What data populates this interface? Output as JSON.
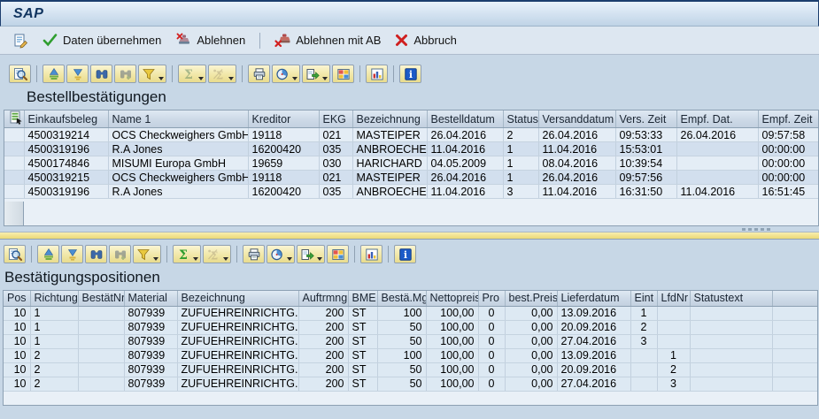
{
  "window": {
    "title": "SAP"
  },
  "app_toolbar": {
    "buttons": [
      {
        "name": "edit-document",
        "label": "",
        "icon": "doc-pencil"
      },
      {
        "name": "accept-data",
        "label": "Daten übernehmen",
        "icon": "green-check"
      },
      {
        "name": "reject",
        "label": "Ablehnen",
        "icon": "stamp-reject"
      },
      {
        "name": "reject-with-ab",
        "label": "Ablehnen mit AB",
        "icon": "stamp-reject-ab"
      },
      {
        "name": "cancel",
        "label": "Abbruch",
        "icon": "red-x"
      }
    ]
  },
  "alv_toolbar": {
    "buttons": [
      {
        "name": "choose-detail",
        "group_end": true
      },
      {
        "name": "sort-ascending"
      },
      {
        "name": "sort-descending"
      },
      {
        "name": "find"
      },
      {
        "name": "find-next"
      },
      {
        "name": "filter",
        "dropdown": true,
        "group_end": true
      },
      {
        "name": "sum",
        "dropdown": true
      },
      {
        "name": "subtotal",
        "dropdown": true,
        "group_end": true
      },
      {
        "name": "print"
      },
      {
        "name": "views",
        "dropdown": true
      },
      {
        "name": "export",
        "dropdown": true
      },
      {
        "name": "layout",
        "group_end": true
      },
      {
        "name": "graphic",
        "group_end": true
      },
      {
        "name": "info"
      }
    ]
  },
  "sections": [
    {
      "title": "Bestellbestätigungen",
      "disabled_buttons": [
        "find-next",
        "sum",
        "subtotal"
      ],
      "columns": [
        "Einkaufsbeleg",
        "Name 1",
        "Kreditor",
        "EKG",
        "Bezeichnung",
        "Bestelldatum",
        "Status",
        "Versanddatum",
        "Vers. Zeit",
        "Empf. Dat.",
        "Empf. Zeit"
      ],
      "rows": [
        [
          "4500319214",
          "OCS Checkweighers GmbH",
          "19118",
          "021",
          "MASTEIPER",
          "26.04.2016",
          "2",
          "26.04.2016",
          "09:53:33",
          "26.04.2016",
          "09:57:58"
        ],
        [
          "4500319196",
          "R.A Jones",
          "16200420",
          "035",
          "ANBROECHER",
          "11.04.2016",
          "1",
          "11.04.2016",
          "15:53:01",
          "",
          "00:00:00"
        ],
        [
          "4500174846",
          "MISUMI Europa GmbH",
          "19659",
          "030",
          "HARICHARD",
          "04.05.2009",
          "1",
          "08.04.2016",
          "10:39:54",
          "",
          "00:00:00"
        ],
        [
          "4500319215",
          "OCS Checkweighers GmbH",
          "19118",
          "021",
          "MASTEIPER",
          "26.04.2016",
          "1",
          "26.04.2016",
          "09:57:56",
          "",
          "00:00:00"
        ],
        [
          "4500319196",
          "R.A Jones",
          "16200420",
          "035",
          "ANBROECHER",
          "11.04.2016",
          "3",
          "11.04.2016",
          "16:31:50",
          "11.04.2016",
          "16:51:45"
        ]
      ]
    },
    {
      "title": "Bestätigungspositionen",
      "disabled_buttons": [
        "find-next",
        "subtotal"
      ],
      "columns": [
        "Pos",
        "Richtung",
        "BestätNr",
        "Material",
        "Bezeichnung",
        "Auftrmng",
        "BME",
        "Bestä.Mg",
        "Nettopreis",
        "Pro",
        "best.Preis",
        "Lieferdatum",
        "Eint",
        "LfdNr",
        "Statustext"
      ],
      "rows": [
        [
          "10",
          "1",
          "",
          "807939",
          "ZUFUEHREINRICHTG.",
          "200",
          "ST",
          "100",
          "100,00",
          "0",
          "0,00",
          "13.09.2016",
          "1",
          "",
          ""
        ],
        [
          "10",
          "1",
          "",
          "807939",
          "ZUFUEHREINRICHTG.",
          "200",
          "ST",
          "50",
          "100,00",
          "0",
          "0,00",
          "20.09.2016",
          "2",
          "",
          ""
        ],
        [
          "10",
          "1",
          "",
          "807939",
          "ZUFUEHREINRICHTG.",
          "200",
          "ST",
          "50",
          "100,00",
          "0",
          "0,00",
          "27.04.2016",
          "3",
          "",
          ""
        ],
        [
          "10",
          "2",
          "",
          "807939",
          "ZUFUEHREINRICHTG.",
          "200",
          "ST",
          "100",
          "100,00",
          "0",
          "0,00",
          "13.09.2016",
          "",
          "1",
          ""
        ],
        [
          "10",
          "2",
          "",
          "807939",
          "ZUFUEHREINRICHTG.",
          "200",
          "ST",
          "50",
          "100,00",
          "0",
          "0,00",
          "20.09.2016",
          "",
          "2",
          ""
        ],
        [
          "10",
          "2",
          "",
          "807939",
          "ZUFUEHREINRICHTG.",
          "200",
          "ST",
          "50",
          "100,00",
          "0",
          "0,00",
          "27.04.2016",
          "",
          "3",
          ""
        ]
      ]
    }
  ],
  "colors": {
    "selected_cell": "#fbd68f",
    "key_column": "#fbe3a3",
    "splitter": "#f1e18c",
    "titlebar_border": "#1c3e6e"
  }
}
